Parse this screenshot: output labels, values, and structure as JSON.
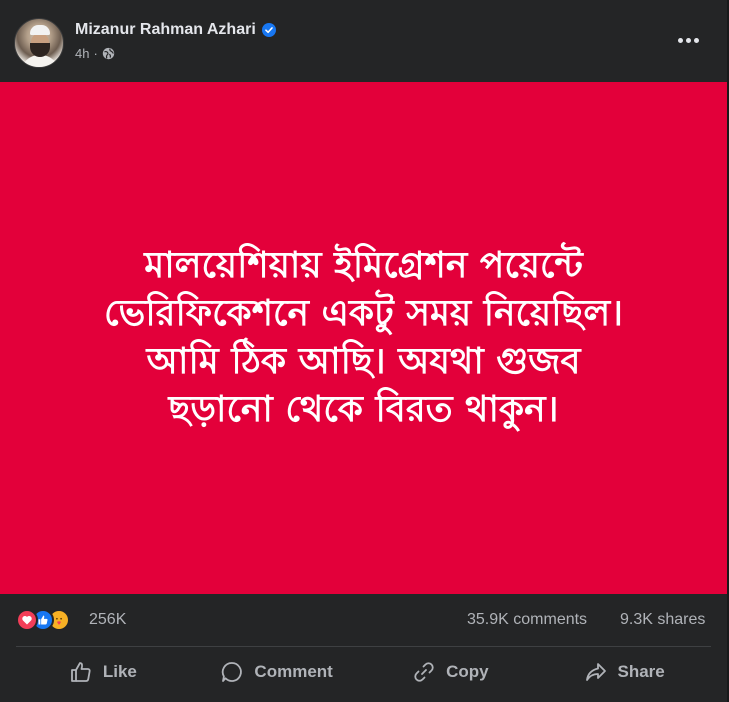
{
  "post": {
    "author": "Mizanur Rahman Azhari",
    "time": "4h",
    "separator": "·",
    "image_lines": [
      "মালয়েশিয়ায় ইমিগ্রেশন পয়েন্টে",
      "ভেরিফিকেশনে একটু সময় নিয়েছিল।",
      "আমি ঠিক আছি। অযথা গুজব",
      "ছড়ানো থেকে বিরত থাকুন।"
    ],
    "image_bg_color": "#e3003a",
    "reactions": {
      "icons": [
        "love-icon",
        "like-icon",
        "care-icon"
      ],
      "count": "256K"
    },
    "comments": "35.9K comments",
    "shares": "9.3K shares",
    "actions": {
      "like": "Like",
      "comment": "Comment",
      "copy": "Copy",
      "share": "Share"
    }
  },
  "colors": {
    "background": "#242526",
    "text_primary": "#e4e6eb",
    "text_secondary": "#b0b3b8",
    "verified_blue": "#1877f2"
  }
}
